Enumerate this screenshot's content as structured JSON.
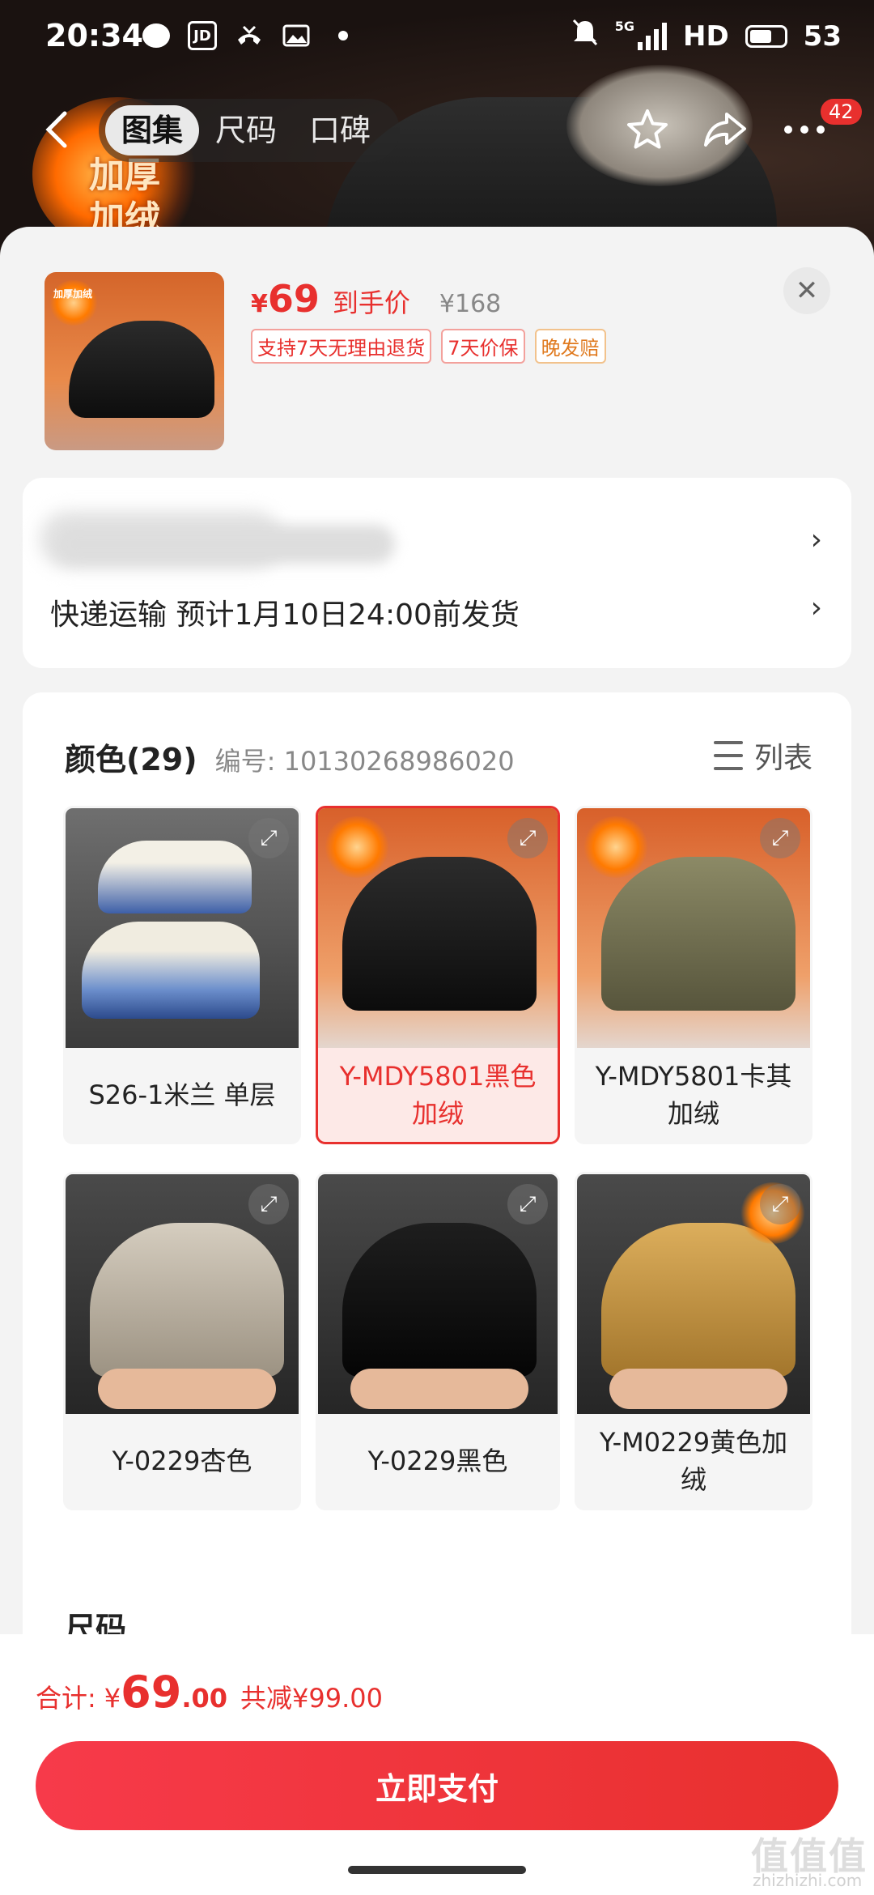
{
  "status_bar": {
    "time": "20:34",
    "jd_icon": "JD",
    "network": "5G",
    "hd": "HD",
    "battery": "53"
  },
  "nav": {
    "tabs": [
      {
        "label": "图集"
      },
      {
        "label": "尺码"
      },
      {
        "label": "口碑"
      }
    ],
    "badge": "42"
  },
  "hero": {
    "promo_text": "加厚\n加绒"
  },
  "product": {
    "thumb_promo": "加厚加绒",
    "price_symbol": "¥",
    "price_now": "69",
    "price_tag": "到手价",
    "price_old": "¥168",
    "tags": [
      {
        "label": "支持7天无理由退货"
      },
      {
        "label": "7天价保"
      },
      {
        "label": "晚发赔"
      }
    ]
  },
  "shipping": {
    "text": "快递运输 预计1月10日24:00前发货"
  },
  "variants": {
    "title": "颜色(29)",
    "code": "编号: 10130268986020",
    "list_label": "列表",
    "items": [
      {
        "label": "S26-1米兰 单层",
        "selected": false
      },
      {
        "label": "Y-MDY5801黑色加绒",
        "selected": true
      },
      {
        "label": "Y-MDY5801卡其加绒",
        "selected": false
      },
      {
        "label": "Y-0229杏色",
        "selected": false
      },
      {
        "label": "Y-0229黑色",
        "selected": false
      },
      {
        "label": "Y-M0229黄色加绒",
        "selected": false
      }
    ],
    "size_title": "尺码"
  },
  "bottom": {
    "total_label": "合计:",
    "total_symbol": "¥",
    "total_int": "69",
    "total_dec": ".00",
    "savings": "共减¥99.00",
    "pay_button": "立即支付"
  },
  "watermark": {
    "brand": "值值值",
    "site": "zhizhizhi.com"
  },
  "colors": {
    "accent": "#e8302e",
    "sheet_bg": "#f3f3f3"
  }
}
